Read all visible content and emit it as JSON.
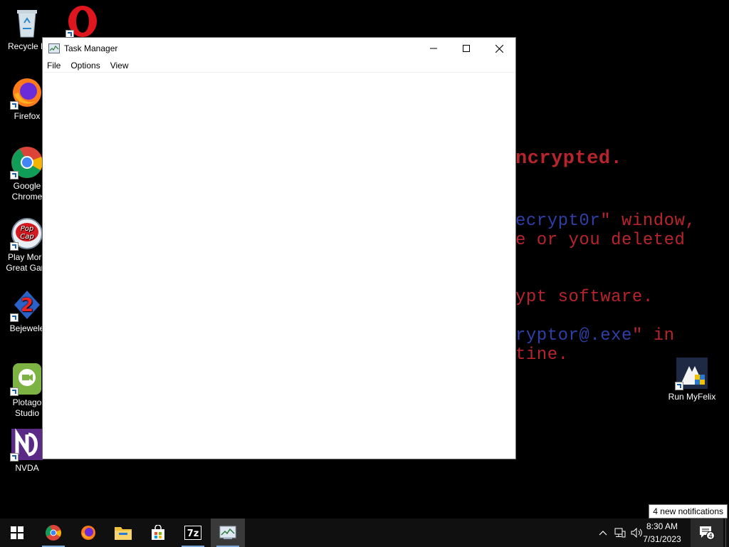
{
  "wallpaper": {
    "lines": [
      {
        "text": "ncrypted.",
        "color": "red"
      },
      {
        "text": "ecrypt0r\" window,",
        "color": "mixed",
        "blue": "ecrypt0r",
        "red": "\" window,"
      },
      {
        "text": "e or you deleted",
        "color": "red"
      },
      {
        "text": "ypt software.",
        "color": "red"
      },
      {
        "text": "ryptor@.exe\" in",
        "color": "mixed",
        "blue": "ryptor@.exe",
        "red": "\" in"
      },
      {
        "text": "tine.",
        "color": "red"
      }
    ]
  },
  "desktop_icons": [
    {
      "label": "Recycle B",
      "icon": "recycle-bin-icon"
    },
    {
      "label": "",
      "icon": "opera-icon"
    },
    {
      "label": "Firefox",
      "icon": "firefox-icon"
    },
    {
      "label": "Google Chrome",
      "icon": "chrome-icon"
    },
    {
      "label": "Play More Great Gam",
      "icon": "popcap-icon"
    },
    {
      "label": "Bejewele",
      "icon": "bejeweled-icon"
    },
    {
      "label": "Plotago Studio",
      "icon": "plotagon-icon"
    },
    {
      "label": "NVDA",
      "icon": "nvda-icon"
    },
    {
      "label": "Run MyFelix",
      "icon": "myfelix-icon"
    }
  ],
  "window": {
    "title": "Task Manager",
    "menu": [
      "File",
      "Options",
      "View"
    ]
  },
  "taskbar": {
    "apps": [
      "start-icon",
      "chrome-icon",
      "firefox-icon",
      "file-explorer-icon",
      "store-icon",
      "7zip-icon",
      "task-manager-icon"
    ],
    "time": "8:30 AM",
    "date": "7/31/2023",
    "notification_count": "4",
    "notification_tooltip": "4 new notifications"
  },
  "colors": {
    "wall_red": "#b8242c",
    "wall_blue": "#2f3fa8",
    "taskbar": "#101010"
  }
}
